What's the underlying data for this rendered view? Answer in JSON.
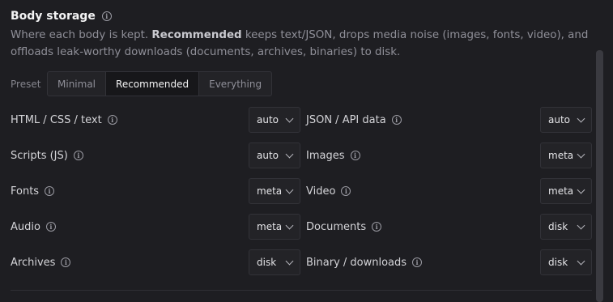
{
  "section": {
    "title": "Body storage",
    "description_lead": "Where each body is kept. ",
    "description_strong": "Recommended",
    "description_rest": " keeps text/JSON, drops media noise (images, fonts, video), and offloads leak-worthy downloads (documents, archives, binaries) to disk."
  },
  "preset": {
    "label": "Preset",
    "options": [
      {
        "label": "Minimal",
        "active": false
      },
      {
        "label": "Recommended",
        "active": true
      },
      {
        "label": "Everything",
        "active": false
      }
    ]
  },
  "rows": [
    {
      "left": {
        "label": "HTML / CSS / text",
        "value": "auto"
      },
      "right": {
        "label": "JSON / API data",
        "value": "auto"
      }
    },
    {
      "left": {
        "label": "Scripts (JS)",
        "value": "auto"
      },
      "right": {
        "label": "Images",
        "value": "meta"
      }
    },
    {
      "left": {
        "label": "Fonts",
        "value": "meta"
      },
      "right": {
        "label": "Video",
        "value": "meta"
      }
    },
    {
      "left": {
        "label": "Audio",
        "value": "meta"
      },
      "right": {
        "label": "Documents",
        "value": "disk"
      }
    },
    {
      "left": {
        "label": "Archives",
        "value": "disk"
      },
      "right": {
        "label": "Binary / downloads",
        "value": "disk"
      }
    }
  ],
  "icons": {
    "info": "info-icon",
    "dropdown": "chevron-down-icon"
  }
}
